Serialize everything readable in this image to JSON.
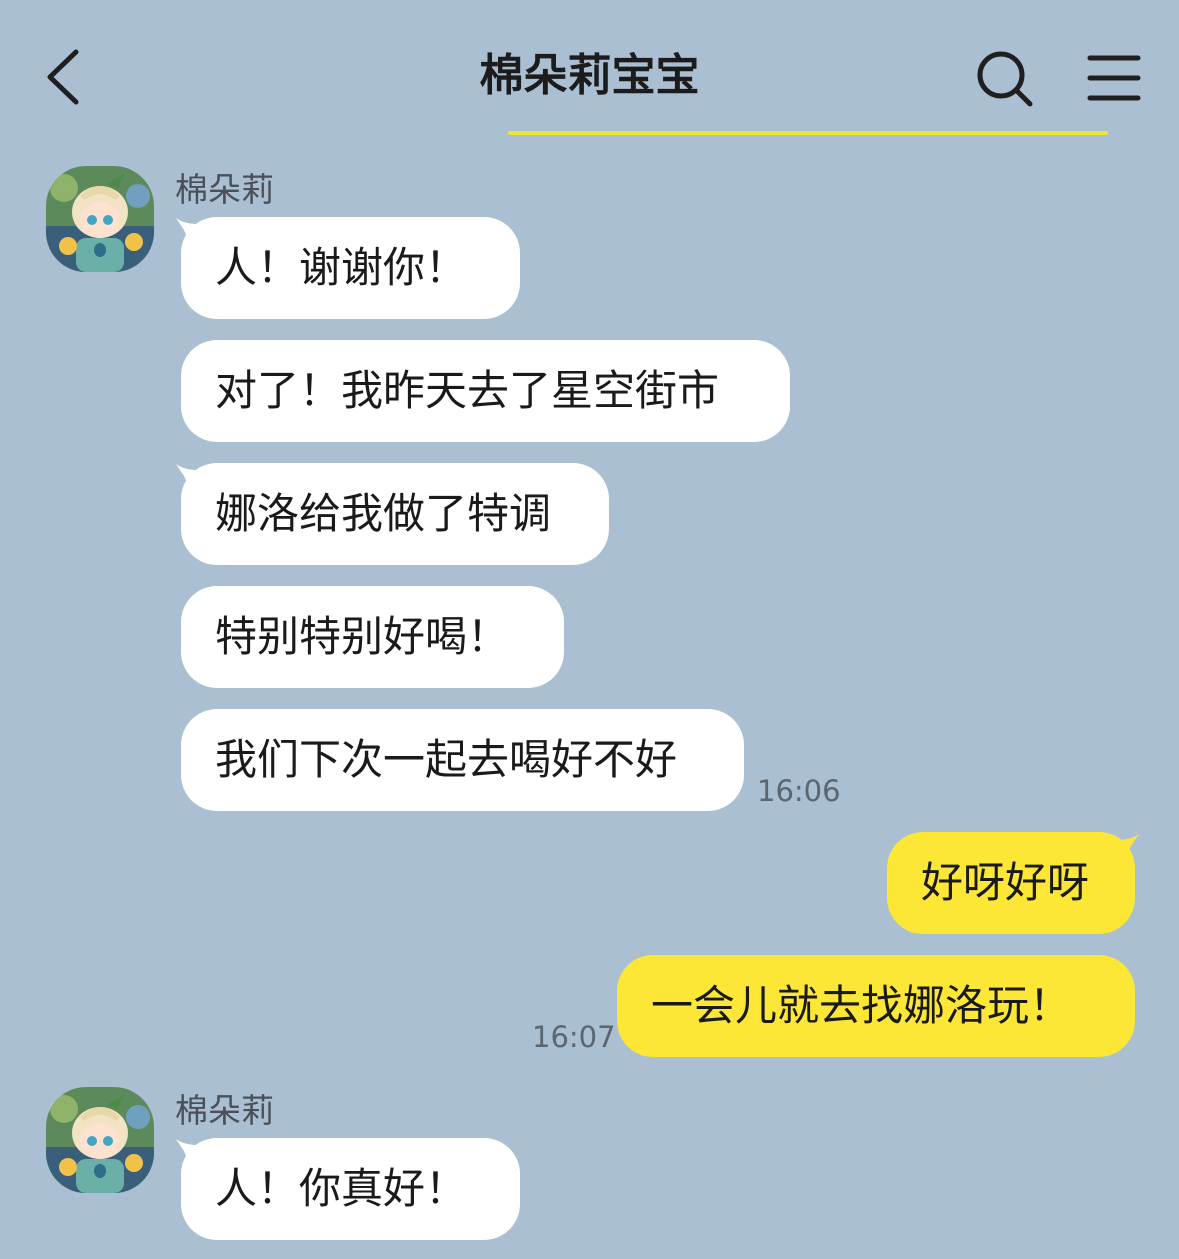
{
  "header": {
    "title": "棉朵莉宝宝"
  },
  "icons": {
    "back": "chevron-left-icon",
    "search": "search-icon",
    "menu": "hamburger-menu-icon"
  },
  "colors": {
    "background": "#aabfd2",
    "incoming_bubble": "#ffffff",
    "outgoing_bubble": "#fce737",
    "title_underline": "#f0e62c"
  },
  "messages": {
    "group1": {
      "sender": "棉朵莉",
      "items": [
        "人！谢谢你！",
        "对了！我昨天去了星空街市",
        "娜洛给我做了特调",
        "特别特别好喝！",
        "我们下次一起去喝好不好"
      ],
      "time": "16:06"
    },
    "group2": {
      "items": [
        "好呀好呀",
        "一会儿就去找娜洛玩！"
      ],
      "time": "16:07"
    },
    "group3": {
      "sender": "棉朵莉",
      "items": [
        "人！你真好！"
      ]
    }
  }
}
